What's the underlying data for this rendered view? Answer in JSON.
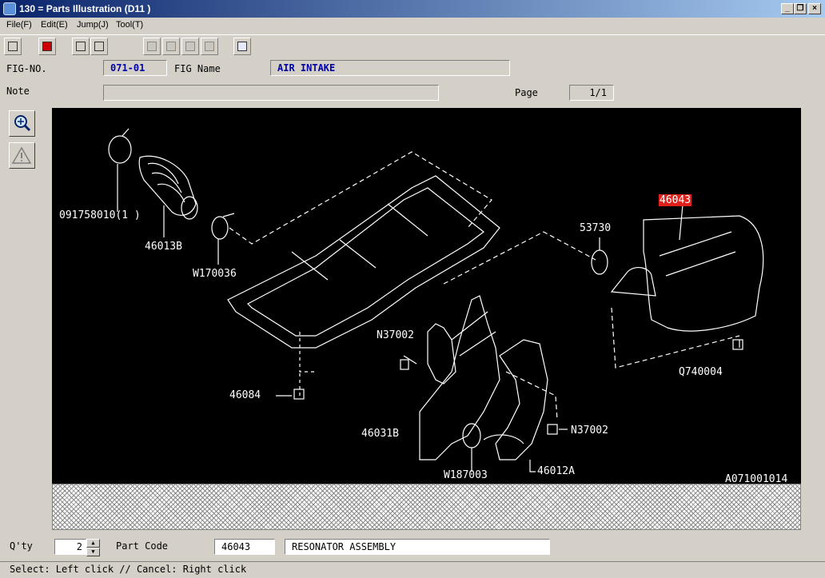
{
  "window": {
    "title": "130 = Parts Illustration (D11  )",
    "minimize": "_",
    "restore": "❐",
    "close": "×"
  },
  "menu": [
    "File(F)",
    "Edit(E)",
    "Jump(J)",
    "Tool(T)"
  ],
  "toolbar": [
    "print-icon",
    "edit-icon",
    "copy-icon",
    "copy-all-icon",
    "fig-prev-icon",
    "fig-next-icon",
    "page-prev-icon",
    "page-next-icon",
    "search-alert-icon"
  ],
  "header": {
    "fig_no_label": "FIG-NO.",
    "fig_no": "071-01",
    "fig_name_label": "FIG Name",
    "fig_name": "AIR INTAKE",
    "note_label": "Note",
    "note": "",
    "page_label": "Page",
    "page": "1/1"
  },
  "illustration": {
    "part_labels": [
      "091758010(1  )",
      "46013B",
      "W170036",
      "46043",
      "53730",
      "N37002",
      "Q740004",
      "46084",
      "46031B",
      "N37002",
      "W187003",
      "46012A"
    ],
    "selected_part": "46043",
    "drawing_code": "A071001014",
    "line_color": "#ffffff",
    "highlight_color": "#e0201a"
  },
  "footer": {
    "qty_label": "Q'ty",
    "qty": "2",
    "part_code_label": "Part Code",
    "part_code": "46043",
    "part_name": "RESONATOR ASSEMBLY"
  },
  "status": "Select: Left click // Cancel: Right click"
}
